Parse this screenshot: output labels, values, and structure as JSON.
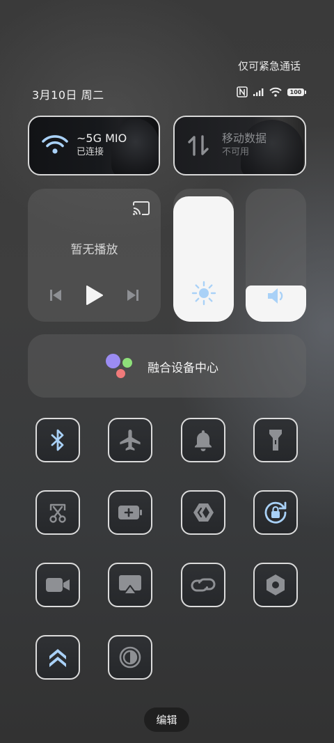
{
  "status_bar": {
    "emergency_text": "仅可紧急通话",
    "date": "3月10日 周二",
    "battery_level": "100",
    "icons": [
      "nfc-icon",
      "signal-icon",
      "wifi-icon",
      "battery-icon"
    ]
  },
  "wifi_tile": {
    "title": "~5G  MIO",
    "subtitle": "已连接",
    "icon": "wifi-icon",
    "active": true
  },
  "data_tile": {
    "title": "移动数据",
    "subtitle": "不可用",
    "icon": "mobile-data-icon",
    "active": false
  },
  "media": {
    "status": "暂无播放",
    "icons": [
      "cast-icon",
      "previous-icon",
      "play-icon",
      "next-icon"
    ]
  },
  "brightness": {
    "level": 0.94,
    "icon": "sun-icon"
  },
  "volume": {
    "level": 0.27,
    "icon": "speaker-icon"
  },
  "fusion": {
    "label": "融合设备中心",
    "dot_colors": [
      "#9b8cf2",
      "#8ee07a",
      "#f07a7a"
    ]
  },
  "quick_settings": [
    {
      "name": "bluetooth",
      "icon": "bluetooth-icon",
      "active": true
    },
    {
      "name": "airplane-mode",
      "icon": "airplane-icon",
      "active": false
    },
    {
      "name": "sound",
      "icon": "bell-icon",
      "active": false
    },
    {
      "name": "flashlight",
      "icon": "flashlight-icon",
      "active": false
    },
    {
      "name": "screenshot",
      "icon": "scissors-icon",
      "active": false
    },
    {
      "name": "battery-saver",
      "icon": "battery-plus-icon",
      "active": false
    },
    {
      "name": "code-share",
      "icon": "code-share-icon",
      "active": false
    },
    {
      "name": "rotation-lock",
      "icon": "rotation-lock-icon",
      "active": true
    },
    {
      "name": "screen-record",
      "icon": "video-camera-icon",
      "active": false
    },
    {
      "name": "screen-cast",
      "icon": "screen-cast-icon",
      "active": false
    },
    {
      "name": "link",
      "icon": "link-icon",
      "active": false
    },
    {
      "name": "settings",
      "icon": "hexagon-icon",
      "active": false
    },
    {
      "name": "performance-mode",
      "icon": "double-chevron-up-icon",
      "active": true
    },
    {
      "name": "dark-mode",
      "icon": "contrast-icon",
      "active": false
    }
  ],
  "edit_button": {
    "label": "编辑"
  },
  "colors": {
    "active_icon": "#a9d1f7",
    "inactive_icon": "#8e9094",
    "panel": "#5a5a5a"
  }
}
